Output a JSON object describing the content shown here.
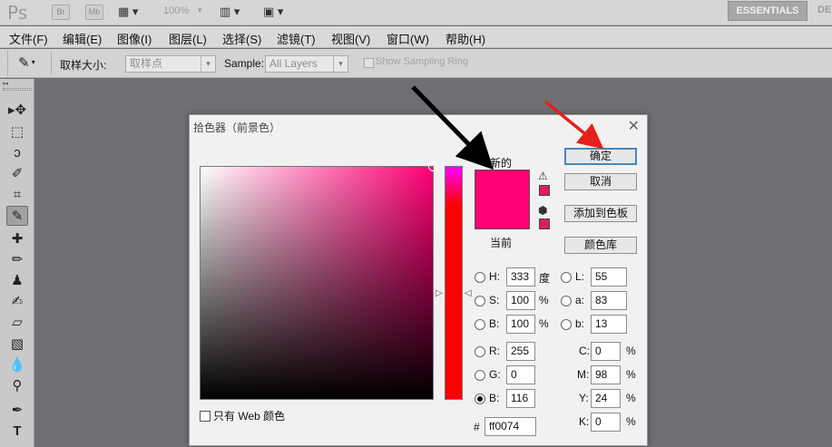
{
  "appbar": {
    "logo": "Ps",
    "bridge_label": "Br",
    "minibridge_label": "Mb",
    "zoom": "100%",
    "workspace": "ESSENTIALS",
    "workspace_next": "DE"
  },
  "menubar": {
    "items": [
      "文件(F)",
      "编辑(E)",
      "图像(I)",
      "图层(L)",
      "选择(S)",
      "滤镜(T)",
      "视图(V)",
      "窗口(W)",
      "帮助(H)"
    ]
  },
  "options": {
    "sample_size_label": "取样大小:",
    "sample_size_value": "取样点",
    "sample_label": "Sample:",
    "sample_value": "All Layers",
    "sampling_ring_label": "Show Sampling Ring"
  },
  "toolbar": {
    "tools": [
      "move-tool",
      "marquee-tool",
      "lasso-tool",
      "quick-select-tool",
      "crop-tool",
      "eyedropper-tool",
      "healing-brush-tool",
      "brush-tool",
      "clone-stamp-tool",
      "history-brush-tool",
      "eraser-tool",
      "gradient-tool",
      "blur-tool",
      "dodge-tool",
      "pen-tool",
      "type-tool"
    ],
    "active": "eyedropper-tool"
  },
  "dialog": {
    "title": "拾色器（前景色）",
    "new_label": "新的",
    "current_label": "当前",
    "ok_label": "确定",
    "cancel_label": "取消",
    "add_swatch_label": "添加到色板",
    "color_libraries_label": "颜色库",
    "web_only_label": "只有 Web 颜色",
    "hex_prefix": "#",
    "hex_value": "ff0074",
    "color": "#ff0074",
    "hsb": {
      "h_label": "H:",
      "h_value": "333",
      "h_unit": "度",
      "s_label": "S:",
      "s_value": "100",
      "s_unit": "%",
      "b_label": "B:",
      "b_value": "100",
      "b_unit": "%"
    },
    "rgb": {
      "r_label": "R:",
      "r_value": "255",
      "g_label": "G:",
      "g_value": "0",
      "b_label": "B:",
      "b_value": "116"
    },
    "lab": {
      "l_label": "L:",
      "l_value": "55",
      "a_label": "a:",
      "a_value": "83",
      "b_label": "b:",
      "b_value": "13"
    },
    "cmyk": {
      "c_label": "C:",
      "c_value": "0",
      "m_label": "M:",
      "m_value": "98",
      "y_label": "Y:",
      "y_value": "24",
      "k_label": "K:",
      "k_value": "0",
      "unit": "%"
    },
    "selected_channel": "B (RGB)"
  }
}
